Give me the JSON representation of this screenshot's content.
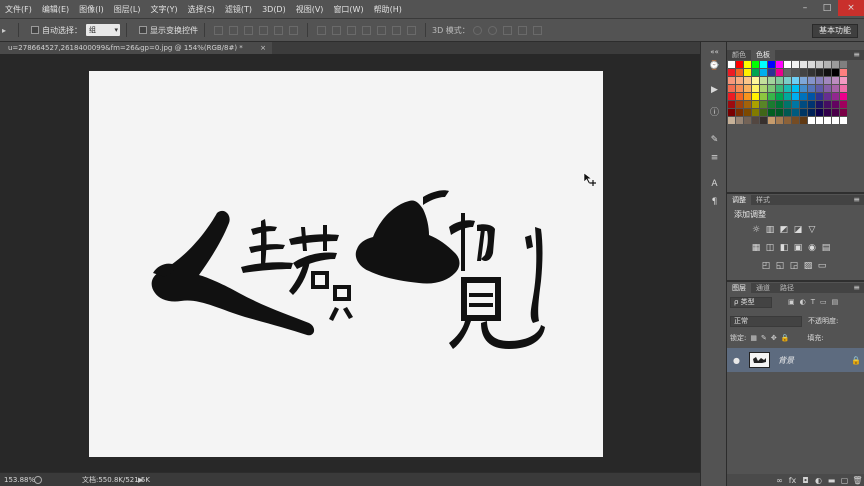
{
  "menubar": {
    "items": [
      "文件(F)",
      "编辑(E)",
      "图像(I)",
      "图层(L)",
      "文字(Y)",
      "选择(S)",
      "滤镜(T)",
      "3D(D)",
      "视图(V)",
      "窗口(W)",
      "帮助(H)"
    ],
    "win_controls": [
      "–",
      "□",
      "×"
    ]
  },
  "options": {
    "auto_select_label": "自动选择：",
    "auto_select_value": "组",
    "show_transform_label": "显示变换控件",
    "mode_3d_label": "3D 模式：",
    "workspace_label": "基本功能"
  },
  "document": {
    "tab_title": "u=278664527,2618400099&fm=26&gp=0.jpg @ 154%(RGB/8#) *",
    "tab_close": "×"
  },
  "status": {
    "zoom": "153.88%",
    "doc_size": "文档:550.8K/521.5K",
    "arrow": "▶"
  },
  "panels": {
    "color_tab": "颜色",
    "swatches_tab": "色板",
    "adjust_tab": "调整",
    "style_tab": "样式",
    "adjust_title": "添加调整",
    "layers_tab": "图层",
    "channels_tab": "通道",
    "paths_tab": "路径",
    "filter_kind": "类型",
    "blend_mode": "正常",
    "opacity_label": "不透明度:",
    "lock_label": "锁定:",
    "fill_label": "填充:",
    "layer_name": "背景",
    "icon_menu": "≡"
  },
  "icons": {
    "eye": "●",
    "lock": "🔒",
    "cursor": "move-cursor-icon"
  },
  "colors": {
    "ui_panel": "#535353",
    "canvas_bg": "#282828",
    "document_bg": "#f4f4f4",
    "layer_selected": "#5d6b7f",
    "close_red": "#c9302c"
  },
  "swatch_colors": [
    "#ffffff",
    "#ff0000",
    "#ffff00",
    "#00ff00",
    "#00ffff",
    "#0000ff",
    "#ff00ff",
    "#ffffff",
    "#f2f2f2",
    "#e6e6e6",
    "#d9d9d9",
    "#c8c8c8",
    "#b3b3b3",
    "#9a9a9a",
    "#808080",
    "#ed1c24",
    "#f26522",
    "#fff200",
    "#00a651",
    "#00aeef",
    "#2e3192",
    "#ec008c",
    "#666666",
    "#555555",
    "#444444",
    "#333333",
    "#222222",
    "#111111",
    "#000000",
    "#ff7f7f",
    "#f7977a",
    "#f9ad81",
    "#fdc68a",
    "#fff79a",
    "#c4df9b",
    "#a2d39c",
    "#82ca9d",
    "#7bcdc8",
    "#6ecff6",
    "#7ea7d8",
    "#8493ca",
    "#8882be",
    "#a187be",
    "#bc8cbf",
    "#f49ac2",
    "#f26c4f",
    "#f68e55",
    "#fbaf5c",
    "#fff467",
    "#acd372",
    "#7cc576",
    "#3bb878",
    "#1abbb4",
    "#00bff3",
    "#438cca",
    "#5574b9",
    "#605ca8",
    "#855fa8",
    "#a763a8",
    "#f06ea9",
    "#ed1c24",
    "#f26522",
    "#f7941d",
    "#fff200",
    "#8dc63f",
    "#39b54a",
    "#00a651",
    "#00a99d",
    "#00aeef",
    "#0072bc",
    "#0054a6",
    "#2e3192",
    "#662d91",
    "#92278f",
    "#ec008c",
    "#9e0b0f",
    "#a0410d",
    "#a3620a",
    "#aba000",
    "#598527",
    "#1a7b30",
    "#007236",
    "#00746b",
    "#0076a3",
    "#004b80",
    "#003471",
    "#1b1464",
    "#440e62",
    "#630460",
    "#9e005d",
    "#790000",
    "#7b2e00",
    "#7d4900",
    "#827b00",
    "#406618",
    "#005e20",
    "#005826",
    "#005952",
    "#005b7f",
    "#003663",
    "#002157",
    "#0d004c",
    "#32004b",
    "#4b0049",
    "#7b0046",
    "#c7b299",
    "#998675",
    "#736357",
    "#534741",
    "#37302d",
    "#c69c6d",
    "#a67c52",
    "#8c6239",
    "#754c24",
    "#603913",
    "#ffffff",
    "#ffffff",
    "#ffffff",
    "#ffffff",
    "#ffffff"
  ]
}
